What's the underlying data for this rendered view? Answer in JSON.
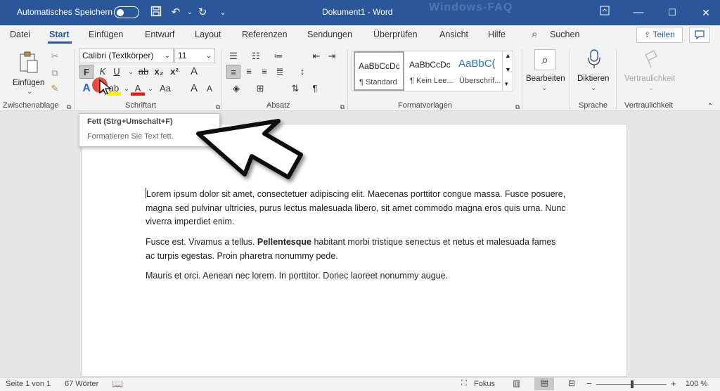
{
  "titlebar": {
    "autosave_label": "Automatisches Speichern",
    "document_title": "Dokument1  -  Word",
    "watermark": "Windows-FAQ",
    "accent": "#2b579a"
  },
  "menu": {
    "items": [
      "Datei",
      "Start",
      "Einfügen",
      "Entwurf",
      "Layout",
      "Referenzen",
      "Sendungen",
      "Überprüfen",
      "Ansicht",
      "Hilfe"
    ],
    "search_label": "Suchen",
    "share_label": "Teilen"
  },
  "ribbon": {
    "clipboard": {
      "paste_label": "Einfügen",
      "group_label": "Zwischenablage"
    },
    "font": {
      "font_name": "Calibri (Textkörper)",
      "font_size": "11",
      "bold": "F",
      "italic": "K",
      "underline": "U",
      "strike": "ab",
      "sub": "x₂",
      "sup": "x²",
      "clear": "A",
      "effects": "A",
      "highlight": "ab",
      "color": "A",
      "case": "Aa",
      "grow": "A",
      "shrink": "A",
      "group_label": "Schriftart"
    },
    "paragraph": {
      "group_label": "Absatz",
      "pilcrow": "¶"
    },
    "styles": {
      "group_label": "Formatvorlagen",
      "items": [
        {
          "preview": "AaBbCcDc",
          "name": "¶ Standard"
        },
        {
          "preview": "AaBbCcDc",
          "name": "¶ Kein Lee..."
        },
        {
          "preview": "AaBbC(",
          "name": "Überschrif..."
        }
      ]
    },
    "editing": {
      "label": "Bearbeiten"
    },
    "speech": {
      "label": "Diktieren",
      "group_label": "Sprache"
    },
    "sensitivity": {
      "label": "Vertraulichkeit",
      "group_label": "Vertraulichkeit"
    }
  },
  "tooltip": {
    "title": "Fett (Strg+Umschalt+F)",
    "description": "Formatieren Sie Text fett."
  },
  "document": {
    "para1": "Lorem ipsum dolor sit amet, consectetuer adipiscing elit. Maecenas porttitor congue massa. Fusce posuere, magna sed pulvinar ultricies, purus lectus malesuada libero, sit amet commodo magna eros quis urna. Nunc viverra imperdiet enim.",
    "para2_before": "Fusce est. Vivamus a tellus. ",
    "para2_bold": "Pellentesque",
    "para2_after": " habitant morbi tristique senectus et netus et malesuada fames ac turpis egestas. Proin pharetra nonummy pede.",
    "para3": "Mauris et orci. Aenean nec lorem. In porttitor. Donec laoreet nonummy augue."
  },
  "status": {
    "page": "Seite 1 von 1",
    "words": "67 Wörter",
    "focus": "Fokus",
    "zoom": "100 %",
    "minus": "−",
    "plus": "+"
  }
}
